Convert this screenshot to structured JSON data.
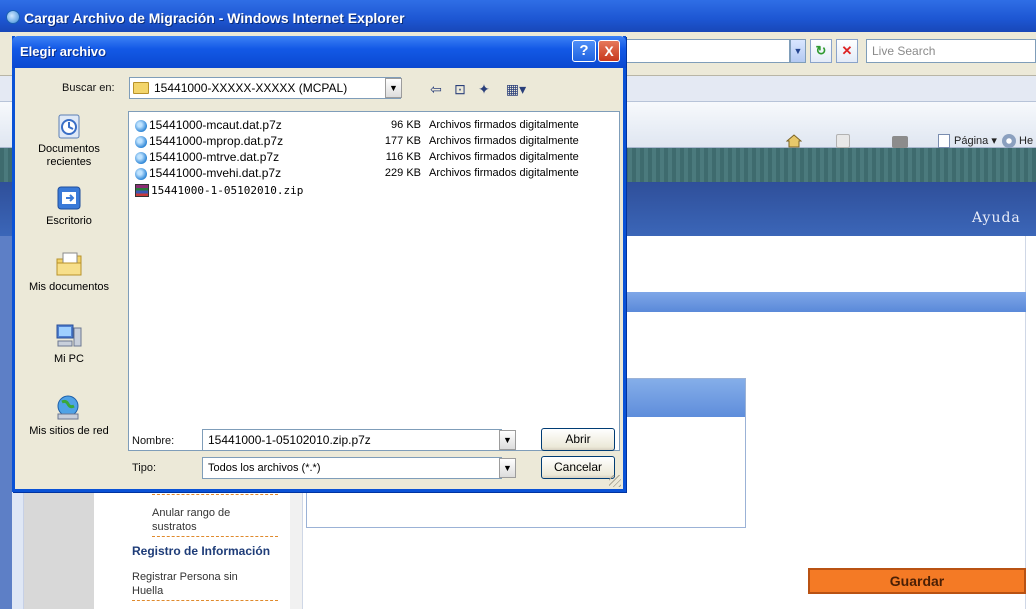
{
  "browser": {
    "title": "Cargar Archivo de Migración - Windows Internet Explorer",
    "search_placeholder": "Live Search",
    "command_bar": {
      "page_label": "Página",
      "help_fragment": "He"
    },
    "page": {
      "help_link": "Ayuda",
      "menu": {
        "items": [
          {
            "label": "Anular rango de sustratos"
          },
          {
            "label": "Registrar Persona sin Huella"
          }
        ],
        "section_heading": "Registro de Información"
      },
      "save_button": "Guardar"
    }
  },
  "dialog": {
    "title": "Elegir archivo",
    "help_button": "?",
    "close_button": "X",
    "look_in_label": "Buscar en:",
    "look_in_value": "15441000-XXXXX-XXXXX (MCPAL)",
    "places": [
      {
        "label": "Documentos recientes"
      },
      {
        "label": "Escritorio"
      },
      {
        "label": "Mis documentos"
      },
      {
        "label": "Mi PC"
      },
      {
        "label": "Mis sitios de red"
      }
    ],
    "files": [
      {
        "name": "15441000-mcaut.dat.p7z",
        "size": "96 KB",
        "type": "Archivos firmados digitalmente",
        "icon": "ie-doc-icon"
      },
      {
        "name": "15441000-mprop.dat.p7z",
        "size": "177 KB",
        "type": "Archivos firmados digitalmente",
        "icon": "ie-doc-icon"
      },
      {
        "name": "15441000-mtrve.dat.p7z",
        "size": "116 KB",
        "type": "Archivos firmados digitalmente",
        "icon": "ie-doc-icon"
      },
      {
        "name": "15441000-mvehi.dat.p7z",
        "size": "229 KB",
        "type": "Archivos firmados digitalmente",
        "icon": "ie-doc-icon"
      },
      {
        "name": "15441000-1-05102010.zip",
        "size": "",
        "type": "",
        "icon": "winrar-archive-icon"
      }
    ],
    "filename_label": "Nombre:",
    "filename_value": "15441000-1-05102010.zip.p7z",
    "filetype_label": "Tipo:",
    "filetype_value": "Todos los archivos (*.*)",
    "open_button": "Abrir",
    "cancel_button": "Cancelar"
  },
  "colors": {
    "title_blue": "#1359e6",
    "save_orange": "#f47a25",
    "page_header_blue": "#2f4f9a"
  }
}
